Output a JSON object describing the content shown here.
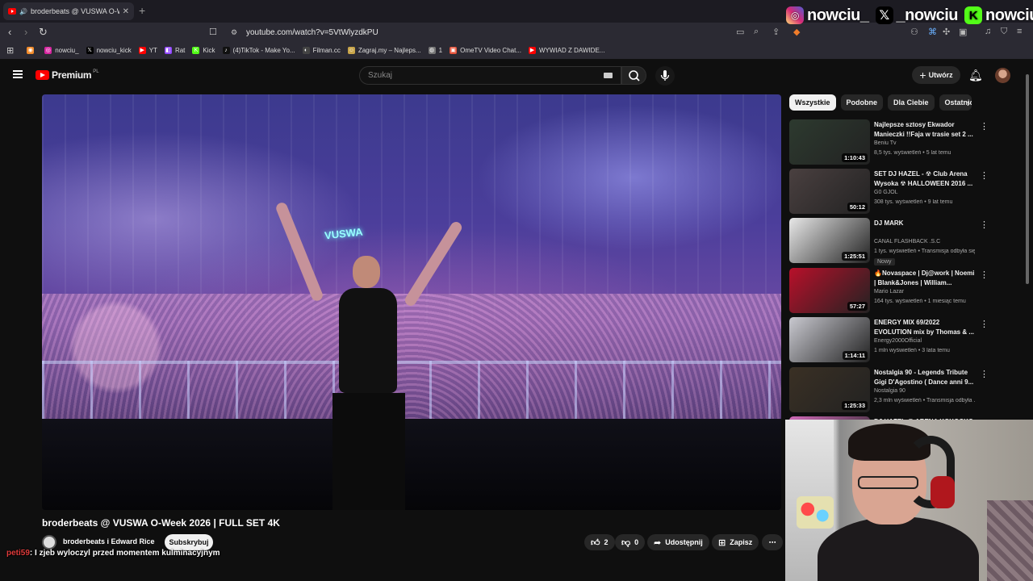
{
  "browser": {
    "tab_title": "broderbeats @ VUSWA O-We",
    "url": "youtube.com/watch?v=5VtWlyzdkPU",
    "bookmarks": [
      {
        "label": "",
        "icon": "rss-icon",
        "color": "#f28b2a"
      },
      {
        "label": "nowciu_",
        "icon": "instagram-icon",
        "color": "#d6249f"
      },
      {
        "label": "nowciu_kick",
        "icon": "x-icon",
        "color": "#000000"
      },
      {
        "label": "YT",
        "icon": "youtube-icon",
        "color": "#ff0000"
      },
      {
        "label": "Rat",
        "icon": "twitch-icon",
        "color": "#9146ff"
      },
      {
        "label": "Kick",
        "icon": "kick-icon",
        "color": "#53fc18"
      },
      {
        "label": "(4)TikTok - Make Yo...",
        "icon": "tiktok-icon",
        "color": "#111111"
      },
      {
        "label": "Filman.cc",
        "icon": "filman-icon",
        "color": "#444444"
      },
      {
        "label": "Zagraj.my – Najleps...",
        "icon": "person-icon",
        "color": "#c8a54a"
      },
      {
        "label": "1",
        "icon": "globe-icon",
        "color": "#777777"
      },
      {
        "label": "OmeTV Video Chat...",
        "icon": "ometv-icon",
        "color": "#e5533a"
      },
      {
        "label": "WYWIAD Z DAWIDE...",
        "icon": "youtube-icon",
        "color": "#ff0000"
      }
    ]
  },
  "overlay": {
    "socials": [
      {
        "label": "nowciu_",
        "icon": "instagram-icon"
      },
      {
        "label": "_nowciu",
        "icon": "x-icon"
      },
      {
        "label": "nowciu",
        "icon": "kick-icon"
      }
    ]
  },
  "youtube": {
    "logo_text": "Premium",
    "logo_region": "PL",
    "search_placeholder": "Szukaj",
    "create_label": "Utwórz",
    "video": {
      "title": "broderbeats @ VUSWA O-Week 2026 | FULL SET 4K",
      "channel": "broderbeats i Edward Rice",
      "subscribe_label": "Subskrybuj",
      "likes": "2",
      "dislikes": "0",
      "share_label": "Udostępnij",
      "save_label": "Zapisz",
      "overlay_sign": "VUSWA"
    },
    "chips": [
      "Wszystkie",
      "Podobne",
      "Dla Ciebie",
      "Ostatnio"
    ],
    "recommendations": [
      {
        "title": "Najlepsze sztosy Ekwador Manieczki !!Faja w trasie set 2 ...",
        "channel": "Beniu Tv",
        "meta": "8,5 tys. wyświetleń • 5 lat temu",
        "duration": "1:10:43",
        "badge": "",
        "thumb": "#2d3a2f"
      },
      {
        "title": "SET DJ HAZEL - ☢ Club Arena Wysoka ☢ HALLOWEEN 2016 ...",
        "channel": "G0 GJOL",
        "meta": "308 tys. wyświetleń • 9 lat temu",
        "duration": "50:12",
        "badge": "",
        "thumb": "#4a4040"
      },
      {
        "title": "DJ MARK",
        "channel": "CANAL FLASHBACK .S.C",
        "meta": "1 tys. wyświetleń • Transmisja odbyła się...",
        "duration": "1:25:51",
        "badge": "Nowy",
        "thumb": "#e8e8e8"
      },
      {
        "title": "🔥Novaspace | Dj@work | Noemi | Blank&Jones | William...",
        "channel": "Mario Lazar",
        "meta": "164 tys. wyświetleń • 1 miesiąc temu",
        "duration": "57:27",
        "badge": "",
        "thumb": "#b8102a"
      },
      {
        "title": "ENERGY MIX 69/2022 EVOLUTION mix by Thomas & ...",
        "channel": "Energy2000Official",
        "meta": "1 mln wyświetleń • 3 lata temu",
        "duration": "1:14:11",
        "badge": "",
        "thumb": "#c9c9d0"
      },
      {
        "title": "Nostalgia 90 - Legends Tribute Gigi D'Agostino ( Dance anni 9...",
        "channel": "Nostalgia 90",
        "meta": "2,3 mln wyświetleń • Transmisja odbyła ...",
        "duration": "1:25:33",
        "badge": "",
        "thumb": "#3a3024"
      },
      {
        "title": "DJ HAZEL @ ARENA KOKOCKO",
        "channel": "",
        "meta": "",
        "duration": "",
        "badge": "",
        "thumb": "#d06ab8"
      }
    ]
  },
  "chat": {
    "user": "peti59",
    "message": ": I zjeb wyloczyl przed momentem kulminacyjnym"
  }
}
